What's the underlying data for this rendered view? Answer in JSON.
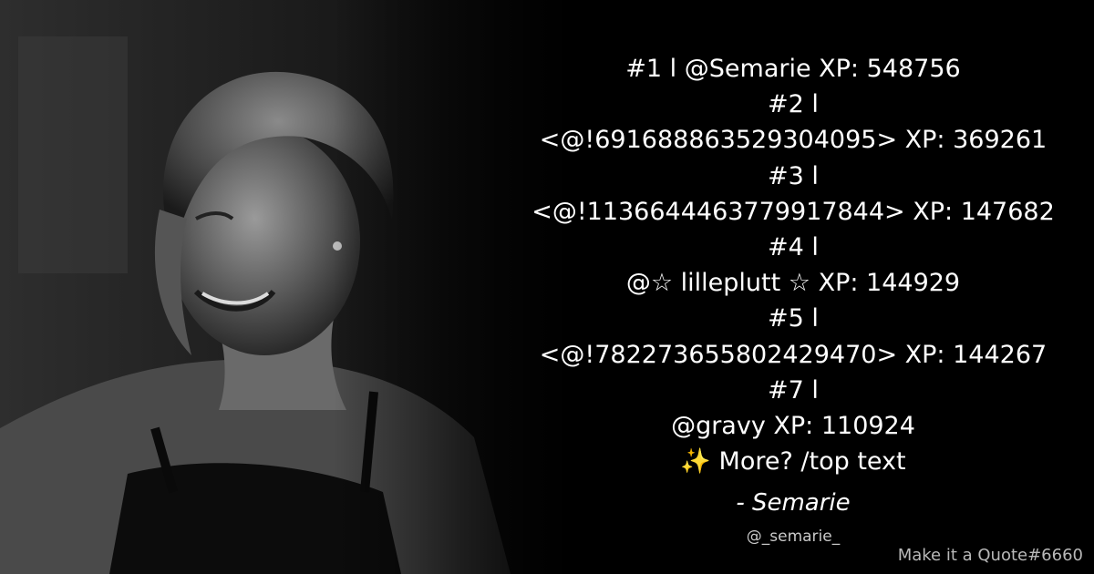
{
  "quote": {
    "lines": [
      "#1 l @Semarie XP: 548756",
      "#2 l",
      "<@!691688863529304095> XP: 369261",
      "#3 l",
      "<@!1136644463779917844> XP: 147682",
      "#4 l",
      "@☆ lilleplutt ☆ XP: 144929",
      "#5 l",
      "<@!782273655802429470> XP: 144267",
      "#7 l",
      "@gravy XP: 110924",
      "✨ More? /top text"
    ]
  },
  "author": "- Semarie",
  "handle": "@_semarie_",
  "watermark": "Make it a Quote#6660"
}
